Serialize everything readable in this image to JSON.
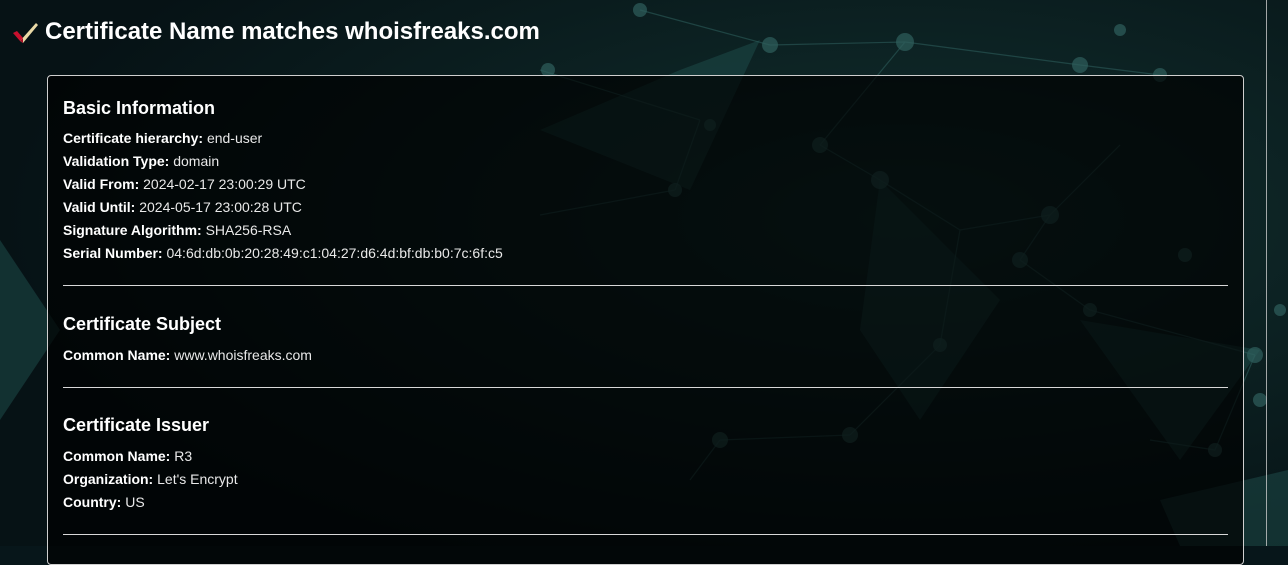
{
  "header": {
    "title": "Certificate Name matches whoisfreaks.com",
    "icon": "check-icon"
  },
  "sections": {
    "basic": {
      "heading": "Basic Information",
      "fields": [
        {
          "label": "Certificate hierarchy:",
          "value": "end-user"
        },
        {
          "label": "Validation Type:",
          "value": "domain"
        },
        {
          "label": "Valid From:",
          "value": "2024-02-17 23:00:29 UTC"
        },
        {
          "label": "Valid Until:",
          "value": "2024-05-17 23:00:28 UTC"
        },
        {
          "label": "Signature Algorithm:",
          "value": "SHA256-RSA"
        },
        {
          "label": "Serial Number:",
          "value": "04:6d:db:0b:20:28:49:c1:04:27:d6:4d:bf:db:b0:7c:6f:c5"
        }
      ]
    },
    "subject": {
      "heading": "Certificate Subject",
      "fields": [
        {
          "label": "Common Name:",
          "value": "www.whoisfreaks.com"
        }
      ]
    },
    "issuer": {
      "heading": "Certificate Issuer",
      "fields": [
        {
          "label": "Common Name:",
          "value": "R3"
        },
        {
          "label": "Organization:",
          "value": "Let's Encrypt"
        },
        {
          "label": "Country:",
          "value": "US"
        }
      ]
    }
  },
  "colors": {
    "background": "#07161a",
    "card": "#000000",
    "accent_teal": "#1f5a58",
    "check": "#c8102e"
  }
}
